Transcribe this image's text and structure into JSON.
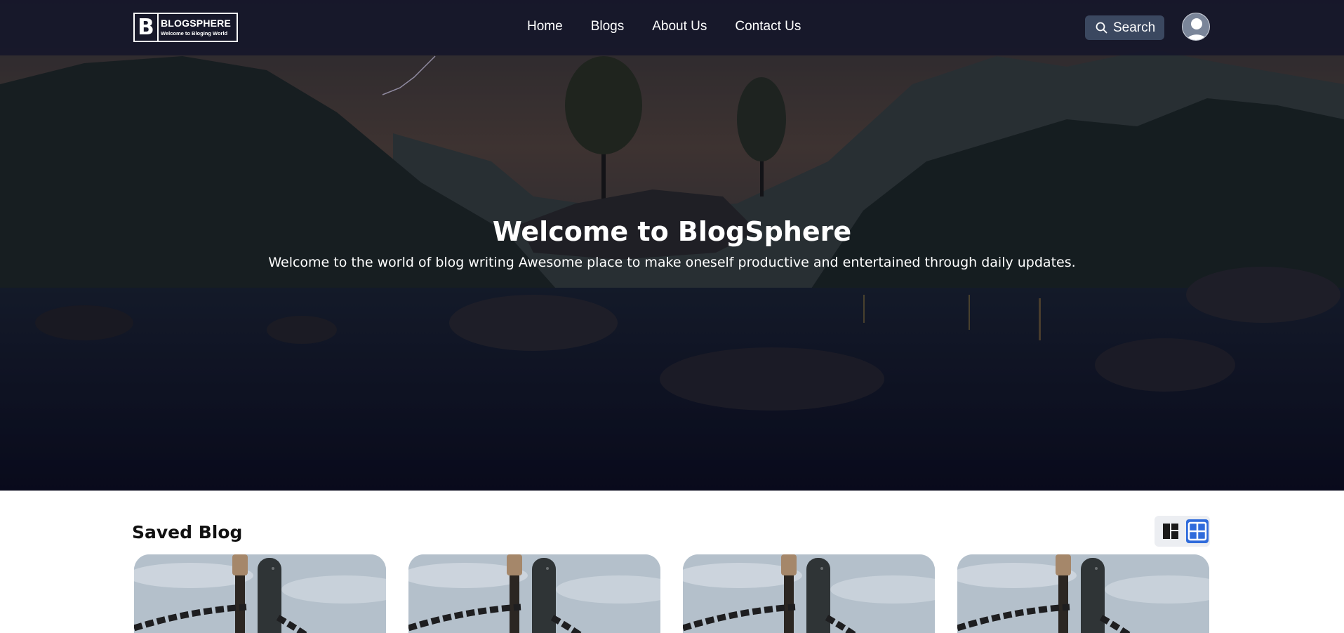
{
  "navbar": {
    "logo": {
      "letter": "B",
      "name": "BLOGSPHERE",
      "tagline": "Welcome to Bloging World"
    },
    "links": [
      {
        "label": "Home"
      },
      {
        "label": "Blogs"
      },
      {
        "label": "About Us"
      },
      {
        "label": "Contact Us"
      }
    ],
    "search": {
      "label": "Search",
      "icon": "search-icon"
    },
    "avatar": {
      "icon": "user-avatar-icon"
    }
  },
  "hero": {
    "title": "Welcome to BlogSphere",
    "subtitle": "Welcome to the world of blog writing Awesome place to make oneself productive and entertained through daily updates."
  },
  "saved": {
    "title": "Saved Blog",
    "view_toggle": [
      {
        "icon": "masonry-layout-icon",
        "active": false
      },
      {
        "icon": "grid-layout-icon",
        "active": true
      }
    ],
    "cards": [
      {
        "image": "guitar-chain-image"
      },
      {
        "image": "guitar-chain-image"
      },
      {
        "image": "guitar-chain-image"
      },
      {
        "image": "guitar-chain-image"
      }
    ]
  },
  "colors": {
    "navbar_bg": "#14162a",
    "search_bg": "#3b4860",
    "toggle_active": "#2f6bdb",
    "text_light": "#ffffff",
    "text_dark": "#111111"
  }
}
